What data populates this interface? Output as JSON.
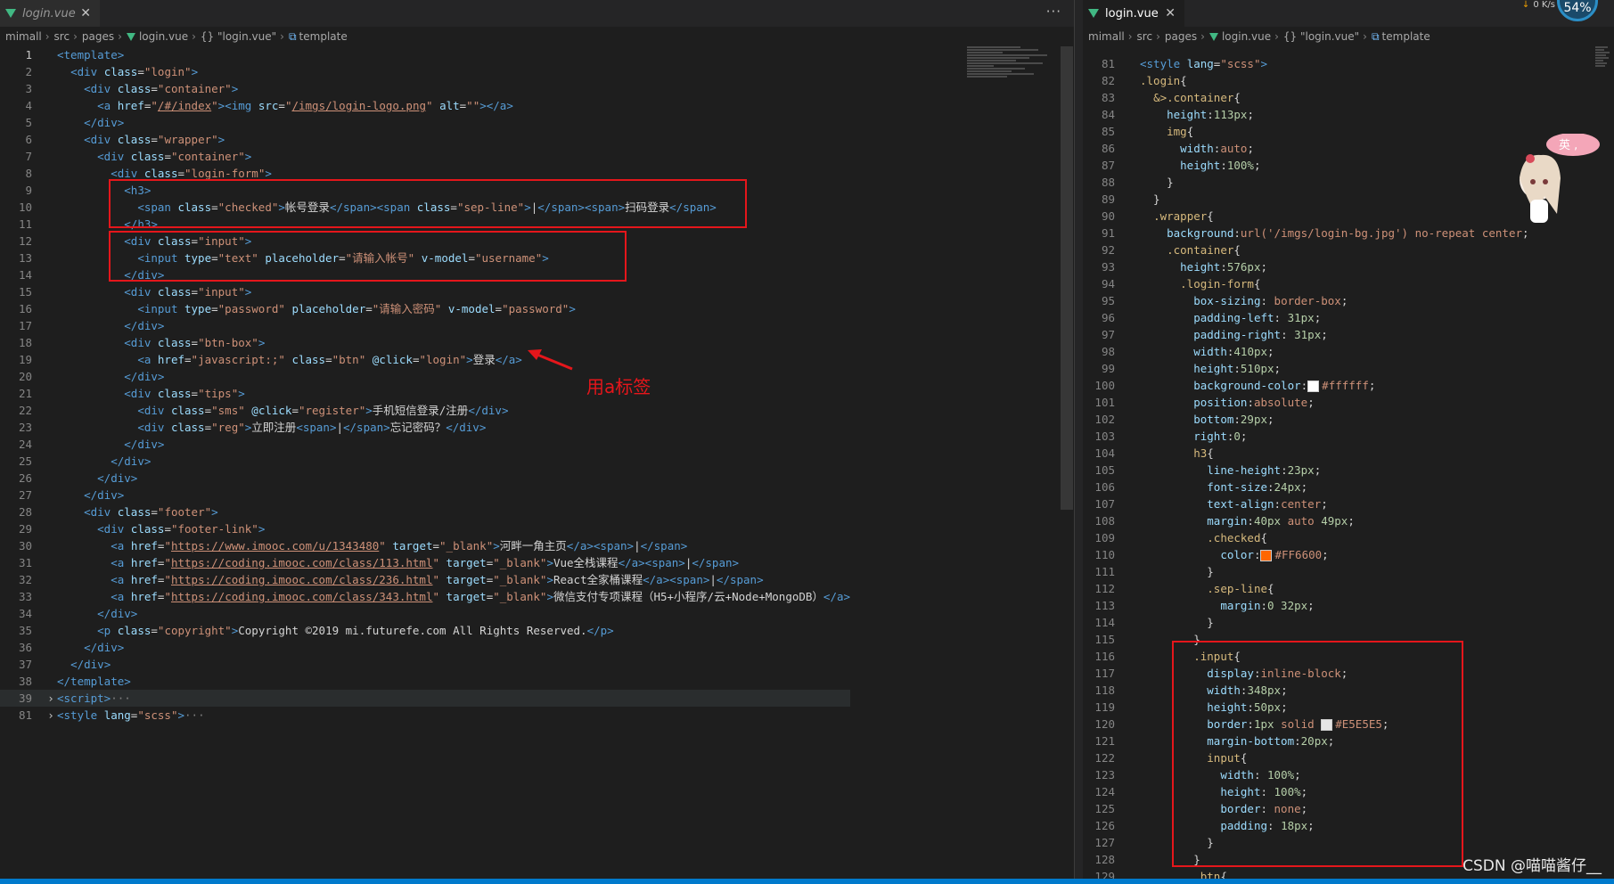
{
  "left": {
    "tab": {
      "label": "login.vue"
    },
    "breadcrumb": [
      "mimall",
      "src",
      "pages",
      "login.vue",
      "{} \"login.vue\"",
      "template"
    ],
    "more": "···",
    "annotation": "用a标签",
    "lines": [
      {
        "n": "1",
        "h": "<span class='tag'>&lt;template&gt;</span>"
      },
      {
        "n": "2",
        "h": "  <span class='tag'>&lt;div</span> <span class='attr'>class</span>=<span class='str'>\"login\"</span><span class='tag'>&gt;</span>"
      },
      {
        "n": "3",
        "h": "    <span class='tag'>&lt;div</span> <span class='attr'>class</span>=<span class='str'>\"container\"</span><span class='tag'>&gt;</span>"
      },
      {
        "n": "4",
        "h": "      <span class='tag'>&lt;a</span> <span class='attr'>href</span>=<span class='str'>\"<u>/#/index</u>\"</span><span class='tag'>&gt;&lt;img</span> <span class='attr'>src</span>=<span class='str'>\"<u>/imgs/login-logo.png</u>\"</span> <span class='attr'>alt</span>=<span class='str'>\"\"</span><span class='tag'>&gt;&lt;/a&gt;</span>"
      },
      {
        "n": "5",
        "h": "    <span class='tag'>&lt;/div&gt;</span>"
      },
      {
        "n": "6",
        "h": "    <span class='tag'>&lt;div</span> <span class='attr'>class</span>=<span class='str'>\"wrapper\"</span><span class='tag'>&gt;</span>"
      },
      {
        "n": "7",
        "h": "      <span class='tag'>&lt;div</span> <span class='attr'>class</span>=<span class='str'>\"container\"</span><span class='tag'>&gt;</span>"
      },
      {
        "n": "8",
        "h": "        <span class='tag'>&lt;div</span> <span class='attr'>class</span>=<span class='str'>\"login-form\"</span><span class='tag'>&gt;</span>"
      },
      {
        "n": "9",
        "h": "          <span class='tag'>&lt;h3&gt;</span>"
      },
      {
        "n": "10",
        "h": "            <span class='tag'>&lt;span</span> <span class='attr'>class</span>=<span class='str'>\"checked\"</span><span class='tag'>&gt;</span>帐号登录<span class='tag'>&lt;/span&gt;&lt;span</span> <span class='attr'>class</span>=<span class='str'>\"sep-line\"</span><span class='tag'>&gt;</span>|<span class='tag'>&lt;/span&gt;&lt;span&gt;</span>扫码登录<span class='tag'>&lt;/span&gt;</span>"
      },
      {
        "n": "11",
        "h": "          <span class='tag'>&lt;/h3&gt;</span>"
      },
      {
        "n": "12",
        "h": "          <span class='tag'>&lt;div</span> <span class='attr'>class</span>=<span class='str'>\"input\"</span><span class='tag'>&gt;</span>"
      },
      {
        "n": "13",
        "h": "            <span class='tag'>&lt;input</span> <span class='attr'>type</span>=<span class='str'>\"text\"</span> <span class='attr'>placeholder</span>=<span class='str'>\"请输入帐号\"</span> <span class='attr'>v-model</span>=<span class='str'>\"username\"</span><span class='tag'>&gt;</span>"
      },
      {
        "n": "14",
        "h": "          <span class='tag'>&lt;/div&gt;</span>"
      },
      {
        "n": "15",
        "h": "          <span class='tag'>&lt;div</span> <span class='attr'>class</span>=<span class='str'>\"input\"</span><span class='tag'>&gt;</span>"
      },
      {
        "n": "16",
        "h": "            <span class='tag'>&lt;input</span> <span class='attr'>type</span>=<span class='str'>\"password\"</span> <span class='attr'>placeholder</span>=<span class='str'>\"请输入密码\"</span> <span class='attr'>v-model</span>=<span class='str'>\"password\"</span><span class='tag'>&gt;</span>"
      },
      {
        "n": "17",
        "h": "          <span class='tag'>&lt;/div&gt;</span>"
      },
      {
        "n": "18",
        "h": "          <span class='tag'>&lt;div</span> <span class='attr'>class</span>=<span class='str'>\"btn-box\"</span><span class='tag'>&gt;</span>"
      },
      {
        "n": "19",
        "h": "            <span class='tag'>&lt;a</span> <span class='attr'>href</span>=<span class='str'>\"javascript:;\"</span> <span class='attr'>class</span>=<span class='str'>\"btn\"</span> <span class='attr'>@click</span>=<span class='str'>\"login\"</span><span class='tag'>&gt;</span>登录<span class='tag'>&lt;/a&gt;</span>"
      },
      {
        "n": "20",
        "h": "          <span class='tag'>&lt;/div&gt;</span>"
      },
      {
        "n": "21",
        "h": "          <span class='tag'>&lt;div</span> <span class='attr'>class</span>=<span class='str'>\"tips\"</span><span class='tag'>&gt;</span>"
      },
      {
        "n": "22",
        "h": "            <span class='tag'>&lt;div</span> <span class='attr'>class</span>=<span class='str'>\"sms\"</span> <span class='attr'>@click</span>=<span class='str'>\"register\"</span><span class='tag'>&gt;</span>手机短信登录/注册<span class='tag'>&lt;/div&gt;</span>"
      },
      {
        "n": "23",
        "h": "            <span class='tag'>&lt;div</span> <span class='attr'>class</span>=<span class='str'>\"reg\"</span><span class='tag'>&gt;</span>立即注册<span class='tag'>&lt;span&gt;</span>|<span class='tag'>&lt;/span&gt;</span>忘记密码？<span class='tag'>&lt;/div&gt;</span>"
      },
      {
        "n": "24",
        "h": "          <span class='tag'>&lt;/div&gt;</span>"
      },
      {
        "n": "25",
        "h": "        <span class='tag'>&lt;/div&gt;</span>"
      },
      {
        "n": "26",
        "h": "      <span class='tag'>&lt;/div&gt;</span>"
      },
      {
        "n": "27",
        "h": "    <span class='tag'>&lt;/div&gt;</span>"
      },
      {
        "n": "28",
        "h": "    <span class='tag'>&lt;div</span> <span class='attr'>class</span>=<span class='str'>\"footer\"</span><span class='tag'>&gt;</span>"
      },
      {
        "n": "29",
        "h": "      <span class='tag'>&lt;div</span> <span class='attr'>class</span>=<span class='str'>\"footer-link\"</span><span class='tag'>&gt;</span>"
      },
      {
        "n": "30",
        "h": "        <span class='tag'>&lt;a</span> <span class='attr'>href</span>=<span class='str'>\"<u>https://www.imooc.com/u/1343480</u>\"</span> <span class='attr'>target</span>=<span class='str'>\"_blank\"</span><span class='tag'>&gt;</span>河畔一角主页<span class='tag'>&lt;/a&gt;&lt;span&gt;</span>|<span class='tag'>&lt;/span&gt;</span>"
      },
      {
        "n": "31",
        "h": "        <span class='tag'>&lt;a</span> <span class='attr'>href</span>=<span class='str'>\"<u>https://coding.imooc.com/class/113.html</u>\"</span> <span class='attr'>target</span>=<span class='str'>\"_blank\"</span><span class='tag'>&gt;</span>Vue全栈课程<span class='tag'>&lt;/a&gt;&lt;span&gt;</span>|<span class='tag'>&lt;/span&gt;</span>"
      },
      {
        "n": "32",
        "h": "        <span class='tag'>&lt;a</span> <span class='attr'>href</span>=<span class='str'>\"<u>https://coding.imooc.com/class/236.html</u>\"</span> <span class='attr'>target</span>=<span class='str'>\"_blank\"</span><span class='tag'>&gt;</span>React全家桶课程<span class='tag'>&lt;/a&gt;&lt;span&gt;</span>|<span class='tag'>&lt;/span&gt;</span>"
      },
      {
        "n": "33",
        "h": "        <span class='tag'>&lt;a</span> <span class='attr'>href</span>=<span class='str'>\"<u>https://coding.imooc.com/class/343.html</u>\"</span> <span class='attr'>target</span>=<span class='str'>\"_blank\"</span><span class='tag'>&gt;</span>微信支付专项课程（H5+小程序/云+Node+MongoDB）<span class='tag'>&lt;/a&gt;</span>"
      },
      {
        "n": "34",
        "h": "      <span class='tag'>&lt;/div&gt;</span>"
      },
      {
        "n": "35",
        "h": "      <span class='tag'>&lt;p</span> <span class='attr'>class</span>=<span class='str'>\"copyright\"</span><span class='tag'>&gt;</span>Copyright ©2019 mi.futurefe.com All Rights Reserved.<span class='tag'>&lt;/p&gt;</span>"
      },
      {
        "n": "36",
        "h": "    <span class='tag'>&lt;/div&gt;</span>"
      },
      {
        "n": "37",
        "h": "  <span class='tag'>&lt;/div&gt;</span>"
      },
      {
        "n": "38",
        "h": "<span class='tag'>&lt;/template&gt;</span>"
      },
      {
        "n": "39",
        "h": "<span class='tag'>&lt;script&gt;</span><span class='br'>···</span>",
        "fold": true,
        "hl": true
      },
      {
        "n": "81",
        "h": "<span class='tag'>&lt;style</span> <span class='attr'>lang</span>=<span class='str'>\"scss\"</span><span class='tag'>&gt;</span><span class='br'>···</span>",
        "fold": true
      }
    ]
  },
  "right": {
    "tab": {
      "label": "login.vue"
    },
    "breadcrumb": [
      "mimall",
      "src",
      "pages",
      "login.vue",
      "{} \"login.vue\"",
      "template"
    ],
    "speed": "0 K/s",
    "cpu": "54%",
    "mascot_text": "英 ,",
    "watermark": "CSDN @喵喵酱仔__",
    "lines": [
      {
        "n": "81",
        "h": "<span class='tag'>&lt;style</span> <span class='attr'>lang</span>=<span class='str'>\"scss\"</span><span class='tag'>&gt;</span>"
      },
      {
        "n": "82",
        "h": "<span class='sel'>.login</span>{"
      },
      {
        "n": "83",
        "h": "  <span class='sel'>&amp;&gt;.container</span>{"
      },
      {
        "n": "84",
        "h": "    <span class='prop'>height</span>:<span class='num'>113px</span>;"
      },
      {
        "n": "85",
        "h": "    <span class='sel'>img</span>{"
      },
      {
        "n": "86",
        "h": "      <span class='prop'>width</span>:<span class='val'>auto</span>;"
      },
      {
        "n": "87",
        "h": "      <span class='prop'>height</span>:<span class='num'>100%</span>;"
      },
      {
        "n": "88",
        "h": "    }"
      },
      {
        "n": "89",
        "h": "  }"
      },
      {
        "n": "90",
        "h": "  <span class='sel'>.wrapper</span>{"
      },
      {
        "n": "91",
        "h": "    <span class='prop'>background</span>:<span class='val'>url(</span><span class='str'>'/imgs/login-bg.jpg'</span><span class='val'>) no-repeat center</span>;"
      },
      {
        "n": "92",
        "h": "    <span class='sel'>.container</span>{"
      },
      {
        "n": "93",
        "h": "      <span class='prop'>height</span>:<span class='num'>576px</span>;"
      },
      {
        "n": "94",
        "h": "      <span class='sel'>.login-form</span>{"
      },
      {
        "n": "95",
        "h": "        <span class='prop'>box-sizing</span>: <span class='val'>border-box</span>;"
      },
      {
        "n": "96",
        "h": "        <span class='prop'>padding-left</span>: <span class='num'>31px</span>;"
      },
      {
        "n": "97",
        "h": "        <span class='prop'>padding-right</span>: <span class='num'>31px</span>;"
      },
      {
        "n": "98",
        "h": "        <span class='prop'>width</span>:<span class='num'>410px</span>;"
      },
      {
        "n": "99",
        "h": "        <span class='prop'>height</span>:<span class='num'>510px</span>;"
      },
      {
        "n": "100",
        "h": "        <span class='prop'>background-color</span>:<span class='swatch' style='background:#ffffff'></span><span class='val'>#ffffff</span>;"
      },
      {
        "n": "101",
        "h": "        <span class='prop'>position</span>:<span class='val'>absolute</span>;"
      },
      {
        "n": "102",
        "h": "        <span class='prop'>bottom</span>:<span class='num'>29px</span>;"
      },
      {
        "n": "103",
        "h": "        <span class='prop'>right</span>:<span class='num'>0</span>;"
      },
      {
        "n": "104",
        "h": "        <span class='sel'>h3</span>{"
      },
      {
        "n": "105",
        "h": "          <span class='prop'>line-height</span>:<span class='num'>23px</span>;"
      },
      {
        "n": "106",
        "h": "          <span class='prop'>font-size</span>:<span class='num'>24px</span>;"
      },
      {
        "n": "107",
        "h": "          <span class='prop'>text-align</span>:<span class='val'>center</span>;"
      },
      {
        "n": "108",
        "h": "          <span class='prop'>margin</span>:<span class='num'>40px</span> <span class='val'>auto</span> <span class='num'>49px</span>;"
      },
      {
        "n": "109",
        "h": "          <span class='sel'>.checked</span>{"
      },
      {
        "n": "110",
        "h": "            <span class='prop'>color</span>:<span class='swatch' style='background:#FF6600'></span><span class='val'>#FF6600</span>;"
      },
      {
        "n": "111",
        "h": "          }"
      },
      {
        "n": "112",
        "h": "          <span class='sel'>.sep-line</span>{"
      },
      {
        "n": "113",
        "h": "            <span class='prop'>margin</span>:<span class='num'>0 32px</span>;"
      },
      {
        "n": "114",
        "h": "          }"
      },
      {
        "n": "115",
        "h": "        }"
      },
      {
        "n": "116",
        "h": "        <span class='sel'>.input</span>{"
      },
      {
        "n": "117",
        "h": "          <span class='prop'>display</span>:<span class='val'>inline-block</span>;"
      },
      {
        "n": "118",
        "h": "          <span class='prop'>width</span>:<span class='num'>348px</span>;"
      },
      {
        "n": "119",
        "h": "          <span class='prop'>height</span>:<span class='num'>50px</span>;"
      },
      {
        "n": "120",
        "h": "          <span class='prop'>border</span>:<span class='num'>1px</span> <span class='val'>solid</span> <span class='swatch' style='background:#E5E5E5'></span><span class='val'>#E5E5E5</span>;"
      },
      {
        "n": "121",
        "h": "          <span class='prop'>margin-bottom</span>:<span class='num'>20px</span>;"
      },
      {
        "n": "122",
        "h": "          <span class='sel'>input</span>{"
      },
      {
        "n": "123",
        "h": "            <span class='prop'>width</span>: <span class='num'>100%</span>;"
      },
      {
        "n": "124",
        "h": "            <span class='prop'>height</span>: <span class='num'>100%</span>;"
      },
      {
        "n": "125",
        "h": "            <span class='prop'>border</span>: <span class='val'>none</span>;"
      },
      {
        "n": "126",
        "h": "            <span class='prop'>padding</span>: <span class='num'>18px</span>;"
      },
      {
        "n": "127",
        "h": "          }"
      },
      {
        "n": "128",
        "h": "        }"
      },
      {
        "n": "129",
        "h": "        <span class='sel'>.btn</span>{"
      }
    ]
  },
  "colors": {
    "accent": "#007acc",
    "annotation": "#e5161b",
    "vue": "#41b883"
  }
}
